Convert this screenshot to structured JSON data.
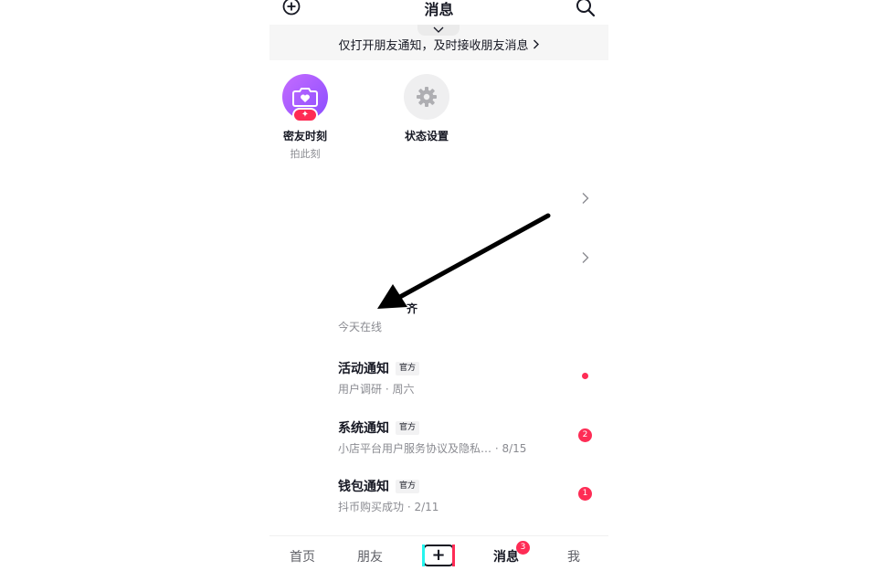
{
  "header": {
    "title": "消息"
  },
  "banner": {
    "text": "仅打开朋友通知，及时接收朋友消息"
  },
  "quick_actions": [
    {
      "label": "密友时刻",
      "sub": "拍此刻"
    },
    {
      "label": "状态设置"
    }
  ],
  "online": {
    "partial_text": "齐",
    "label": "今天在线"
  },
  "notifications": [
    {
      "name": "活动通知",
      "tag": "官方",
      "desc": "用户调研 · 周六",
      "indicator": "dot"
    },
    {
      "name": "系统通知",
      "tag": "官方",
      "desc": "小店平台用户服务协议及隐私…  · 8/15",
      "count": "2"
    },
    {
      "name": "钱包通知",
      "tag": "官方",
      "desc": "抖币购买成功 · 2/11",
      "count": "1"
    }
  ],
  "tabbar": {
    "home": "首页",
    "friends": "朋友",
    "add": "+",
    "messages": "消息",
    "messages_badge": "3",
    "me": "我"
  },
  "colors": {
    "accent": "#fe2c55",
    "purple": "#a55bff",
    "cyan": "#25f4ee"
  },
  "icons": [
    "plus-circle-icon",
    "search-icon",
    "chevron-down-icon",
    "chevron-right-icon",
    "camera-heart-icon",
    "sparkle-icon",
    "gear-icon",
    "annotation-arrow"
  ]
}
